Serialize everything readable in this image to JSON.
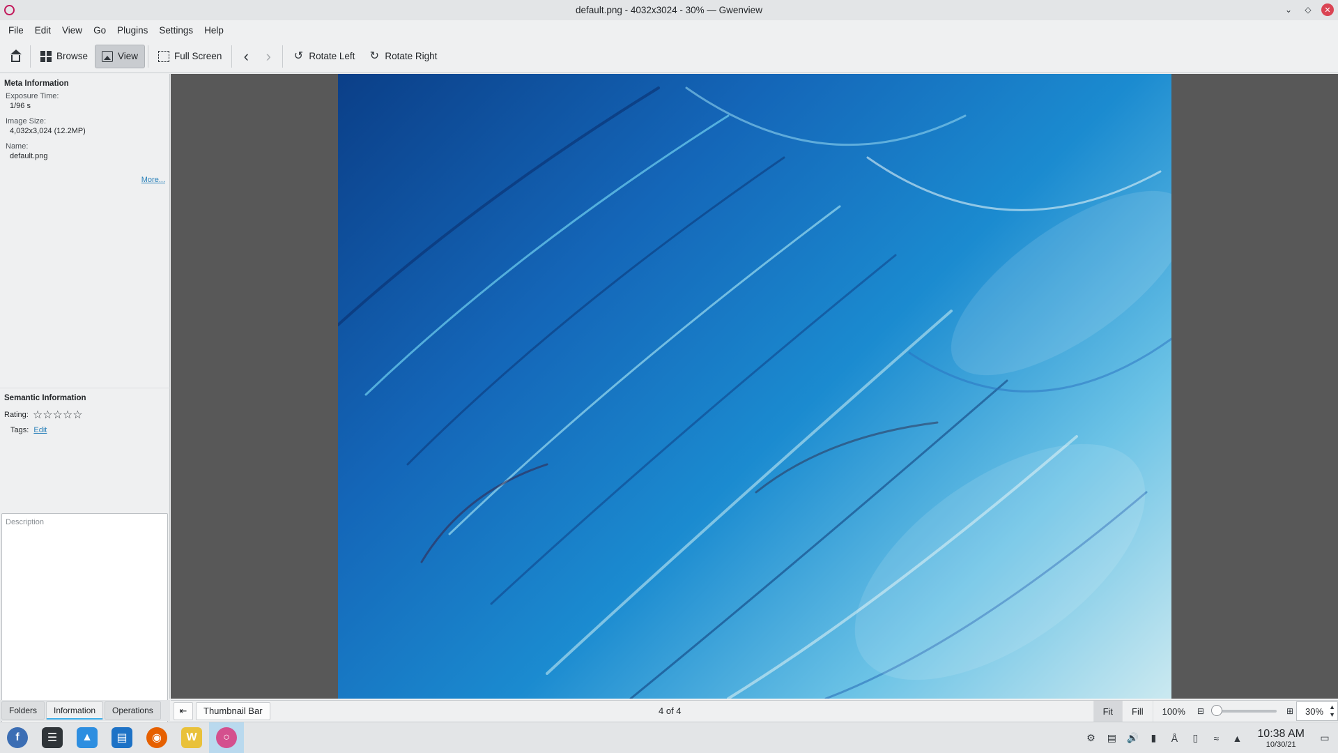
{
  "window": {
    "title": "default.png - 4032x3024 - 30% — Gwenview"
  },
  "menu": [
    "File",
    "Edit",
    "View",
    "Go",
    "Plugins",
    "Settings",
    "Help"
  ],
  "toolbar": {
    "browse": "Browse",
    "view": "View",
    "fullscreen": "Full Screen",
    "rotate_left": "Rotate Left",
    "rotate_right": "Rotate Right"
  },
  "meta": {
    "title": "Meta Information",
    "exposure_label": "Exposure Time:",
    "exposure_value": "1/96 s",
    "size_label": "Image Size:",
    "size_value": "4,032x3,024 (12.2MP)",
    "name_label": "Name:",
    "name_value": "default.png",
    "more": "More..."
  },
  "semantic": {
    "title": "Semantic Information",
    "rating_label": "Rating:",
    "rating": 0,
    "tags_label": "Tags:",
    "tags_edit": "Edit",
    "description_placeholder": "Description"
  },
  "sidebar_tabs": [
    "Folders",
    "Information",
    "Operations"
  ],
  "status": {
    "thumbnail_bar": "Thumbnail Bar",
    "page": "4 of 4",
    "fit": "Fit",
    "fill": "Fill",
    "hundred": "100%",
    "zoom": "30%"
  },
  "taskbar": {
    "time": "10:38 AM",
    "date": "10/30/21"
  }
}
